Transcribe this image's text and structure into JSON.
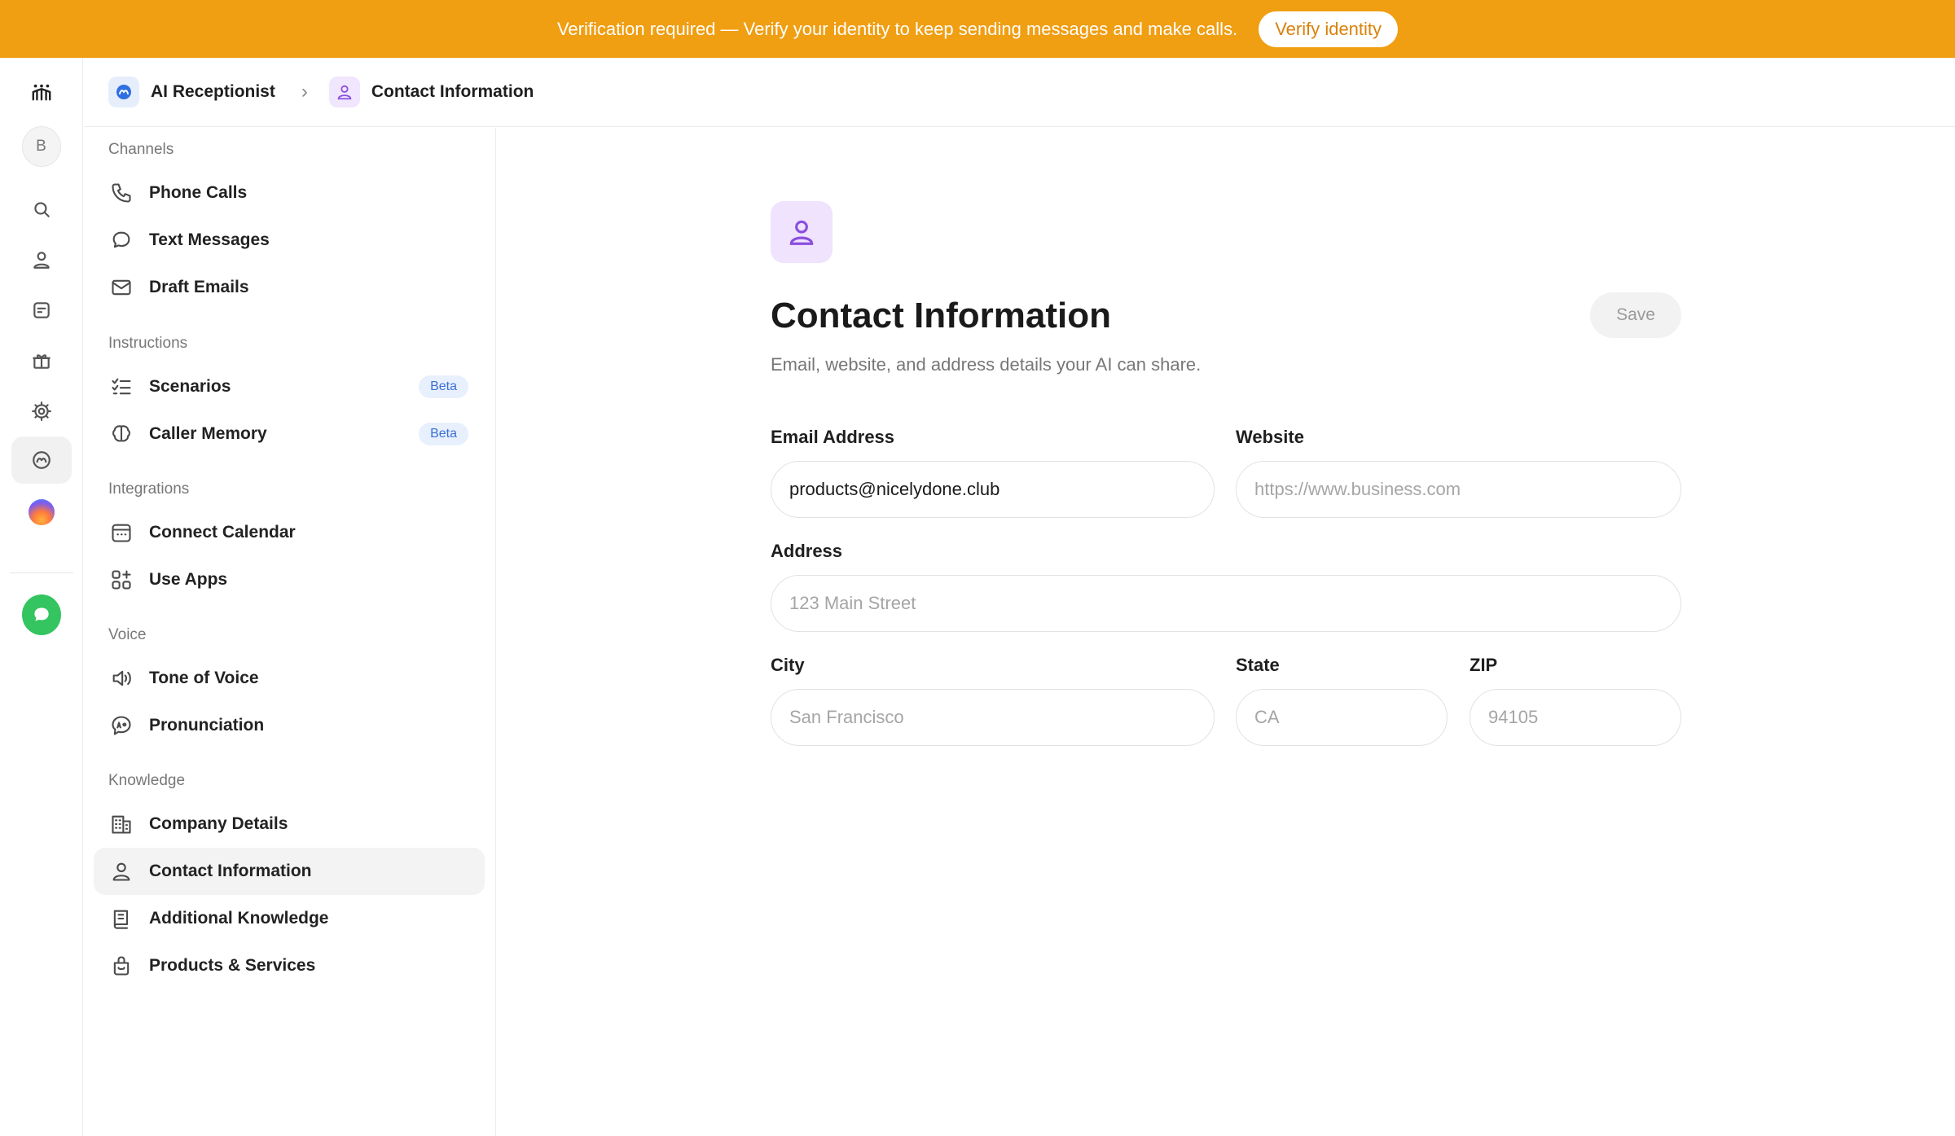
{
  "banner": {
    "text": "Verification required — Verify your identity to keep sending messages and make calls.",
    "button_label": "Verify identity"
  },
  "rail": {
    "avatar_letter": "B",
    "icons": [
      "logo-icon",
      "search-icon",
      "person-icon",
      "note-icon",
      "gift-icon",
      "settings-icon",
      "receptionist-icon",
      "orb-icon",
      "chat-icon"
    ]
  },
  "breadcrumb": {
    "root_label": "AI Receptionist",
    "current_label": "Contact Information"
  },
  "menu": {
    "sections": {
      "channels": "Channels",
      "instructions": "Instructions",
      "integrations": "Integrations",
      "voice": "Voice",
      "knowledge": "Knowledge"
    },
    "items": {
      "phone_calls": "Phone Calls",
      "text_messages": "Text Messages",
      "draft_emails": "Draft Emails",
      "scenarios": "Scenarios",
      "caller_memory": "Caller Memory",
      "connect_calendar": "Connect Calendar",
      "use_apps": "Use Apps",
      "tone_of_voice": "Tone of Voice",
      "pronunciation": "Pronunciation",
      "company_details": "Company Details",
      "contact_information": "Contact Information",
      "additional_knowledge": "Additional Knowledge",
      "products_services": "Products & Services"
    },
    "beta_label": "Beta"
  },
  "main": {
    "title": "Contact Information",
    "subtitle": "Email, website, and address details your AI can share.",
    "save_label": "Save",
    "email": {
      "label": "Email Address",
      "value": "products@nicelydone.club",
      "placeholder": ""
    },
    "website": {
      "label": "Website",
      "value": "",
      "placeholder": "https://www.business.com"
    },
    "address": {
      "label": "Address",
      "value": "",
      "placeholder": "123 Main Street"
    },
    "city": {
      "label": "City",
      "value": "",
      "placeholder": "San Francisco"
    },
    "state": {
      "label": "State",
      "value": "",
      "placeholder": "CA"
    },
    "zip": {
      "label": "ZIP",
      "value": "",
      "placeholder": "94105"
    }
  },
  "colors": {
    "banner": "#F09E12",
    "accent_purple": "#8A4FE0",
    "beta_text": "#3B6FD6",
    "chat_green": "#34C460"
  }
}
